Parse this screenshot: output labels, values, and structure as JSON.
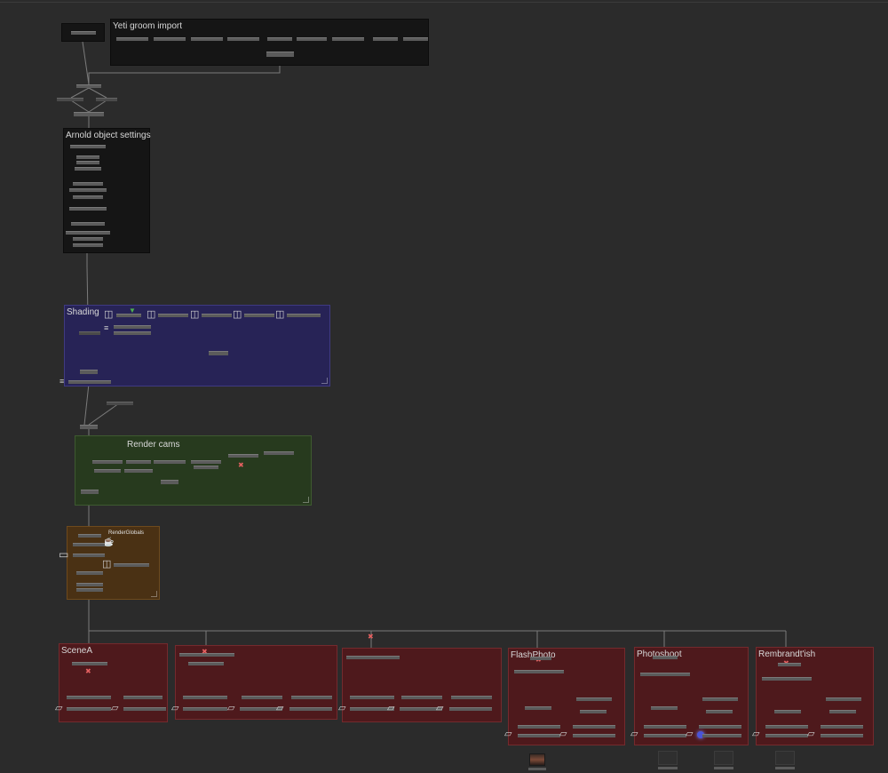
{
  "app": {
    "type": "node-graph-editor"
  },
  "backdrops": [
    {
      "id": "yeti",
      "label": "Yeti groom import"
    },
    {
      "id": "arnold",
      "label": "Arnold object settings"
    },
    {
      "id": "shading",
      "label": "Shading"
    },
    {
      "id": "rendercams",
      "label": "Render  cams"
    },
    {
      "id": "renderglobals",
      "label": "RenderGlobals"
    },
    {
      "id": "scenea",
      "label": "SceneA"
    },
    {
      "id": "unnamed1",
      "label": ""
    },
    {
      "id": "unnamed2",
      "label": ""
    },
    {
      "id": "flashphoto",
      "label": "FlashPhoto"
    },
    {
      "id": "photoshoot",
      "label": "Photoshoot"
    },
    {
      "id": "rembrandt",
      "label": "Rembrandt'ish"
    }
  ],
  "colors": {
    "background": "#2b2b2b",
    "backdrop_dark": "#151515",
    "backdrop_blue": "#272356",
    "backdrop_green": "#273a1e",
    "backdrop_orange": "#4a3114",
    "backdrop_red": "#4e191c",
    "wire": "#8a8a8a",
    "highlight": "#4a54d8"
  },
  "icons": {
    "material": "material-icon",
    "stack": "stack-icon",
    "camera": "camera-icon",
    "clapper": "clapperboard-icon",
    "folder": "folder-icon",
    "teapot": "teapot-icon",
    "marker": "green-marker-icon"
  }
}
